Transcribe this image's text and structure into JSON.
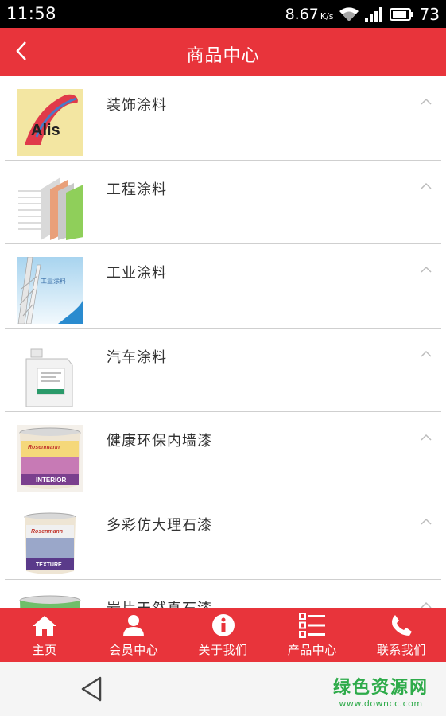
{
  "status_bar": {
    "time": "11:58",
    "speed": "8.67",
    "speed_unit": "K/s",
    "battery": "73"
  },
  "header": {
    "title": "商品中心",
    "back_icon": "chevron-left-icon"
  },
  "products": [
    {
      "name": "装饰涂料",
      "thumb": "alis-logo",
      "logo_text": "Alis"
    },
    {
      "name": "工程涂料",
      "thumb": "layered-wall"
    },
    {
      "name": "工业涂料",
      "thumb": "steel-structure",
      "thumb_text": "工业涂料"
    },
    {
      "name": "汽车涂料",
      "thumb": "white-jug"
    },
    {
      "name": "健康环保内墙漆",
      "thumb": "paint-bucket-interior",
      "brand_text": "Rosenmann",
      "bucket_label": "INTERIOR"
    },
    {
      "name": "多彩仿大理石漆",
      "thumb": "paint-bucket-texture",
      "brand_text": "Rosenmann",
      "bucket_label": "TEXTURE"
    },
    {
      "name": "岩片天然真石漆",
      "thumb": "paint-bucket-green"
    }
  ],
  "bottom_nav": [
    {
      "label": "主页",
      "icon": "home-icon"
    },
    {
      "label": "会员中心",
      "icon": "user-icon"
    },
    {
      "label": "关于我们",
      "icon": "info-icon"
    },
    {
      "label": "产品中心",
      "icon": "list-icon"
    },
    {
      "label": "联系我们",
      "icon": "phone-icon"
    }
  ],
  "watermark": {
    "title": "绿色资源网",
    "url": "www.downcc.com"
  },
  "colors": {
    "accent": "#e8343b",
    "watermark": "#2eab4a"
  }
}
